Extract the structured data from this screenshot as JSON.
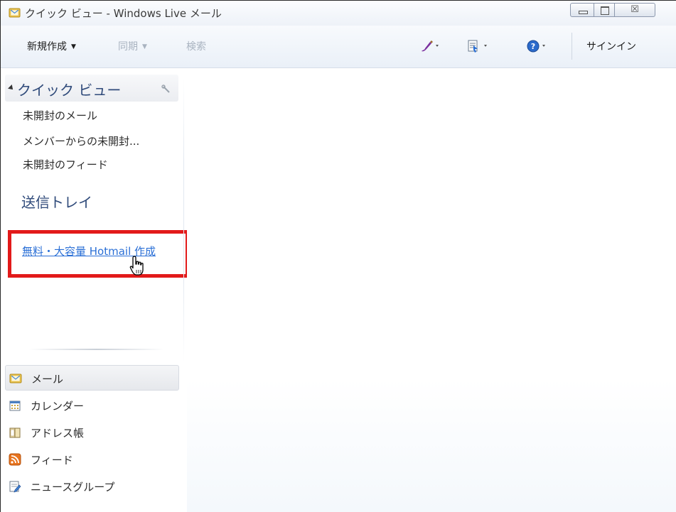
{
  "window": {
    "title": "クイック ビュー - Windows Live メール",
    "controls": {
      "close_glyph": "☒"
    }
  },
  "toolbar": {
    "new_label": "新規作成",
    "sync_label": "同期",
    "search_label": "検索",
    "signin_label": "サインイン",
    "caret": "▼"
  },
  "quick_view": {
    "title": "クイック ビュー",
    "items": [
      {
        "label": "未開封のメール"
      },
      {
        "label": "メンバーからの未開封..."
      },
      {
        "label": "未開封のフィード"
      }
    ]
  },
  "folders": {
    "outbox": "送信トレイ"
  },
  "promo": {
    "hotmail_link": "無料・大容量 Hotmail 作成"
  },
  "nav": {
    "items": [
      {
        "label": "メール",
        "icon": "mail-icon",
        "selected": true
      },
      {
        "label": "カレンダー",
        "icon": "calendar-icon"
      },
      {
        "label": "アドレス帳",
        "icon": "address-book-icon"
      },
      {
        "label": "フィード",
        "icon": "feed-icon"
      },
      {
        "label": "ニュースグループ",
        "icon": "newsgroup-icon"
      }
    ]
  },
  "colors": {
    "highlight_border": "#e21a1a",
    "link": "#2a6fd6",
    "heading": "#2f4a7a"
  }
}
